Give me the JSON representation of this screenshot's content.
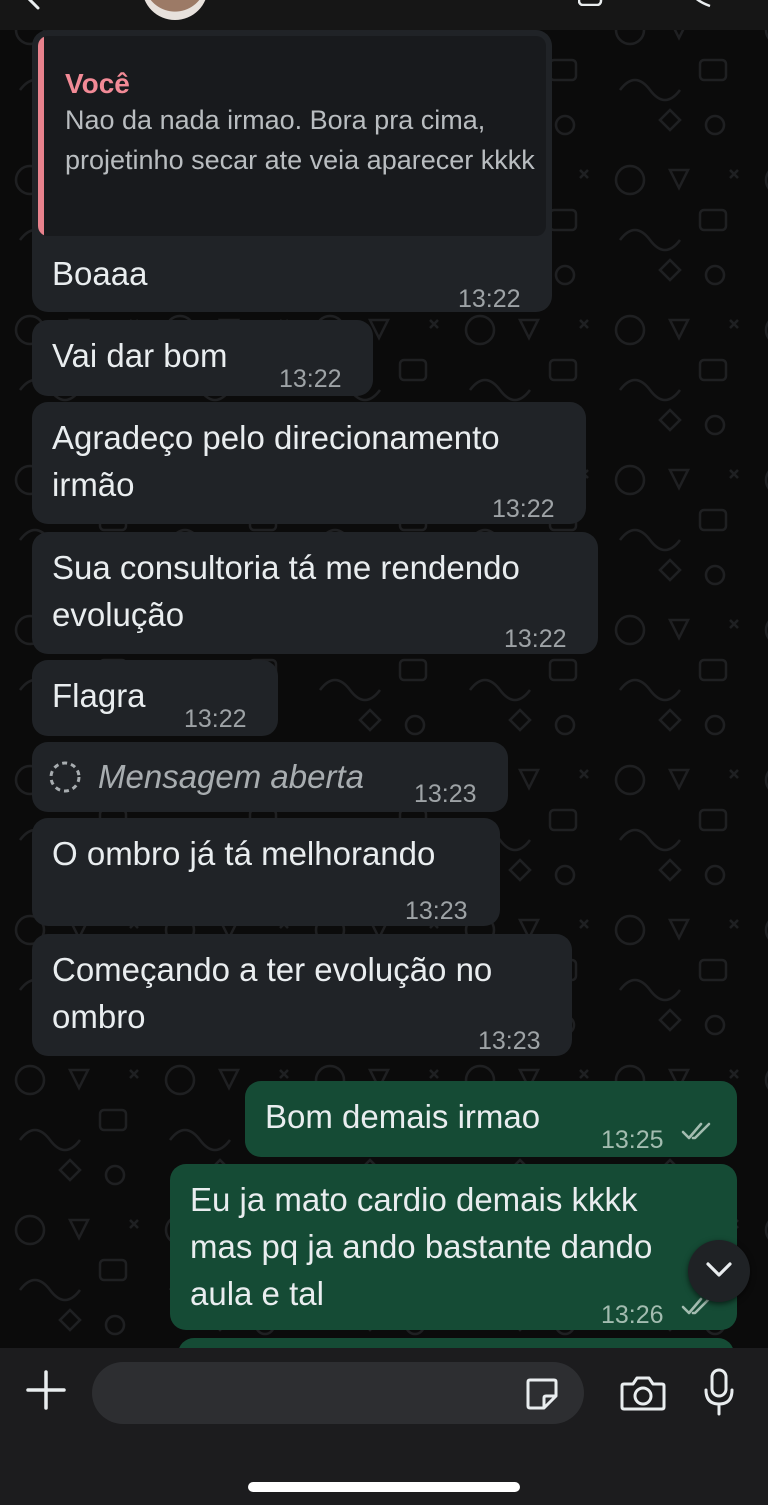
{
  "colors": {
    "incoming_bubble": "#202327",
    "outgoing_bubble": "#154b35",
    "quote_accent": "#e8828d",
    "read_ticks": "#a3bcb0"
  },
  "quoted": {
    "author": "Você",
    "text": "Nao da nada irmao. Bora pra cima, projetinho secar ate veia aparecer kkkk"
  },
  "messages": [
    {
      "dir": "in",
      "lines": [
        "Boaaa"
      ],
      "time": "13:22"
    },
    {
      "dir": "in",
      "lines": [
        "Vai dar bom"
      ],
      "time": "13:22"
    },
    {
      "dir": "in",
      "lines": [
        "Agradeço pelo direcionamento",
        "irmão"
      ],
      "time": "13:22"
    },
    {
      "dir": "in",
      "lines": [
        "Sua consultoria tá me rendendo",
        "evolução"
      ],
      "time": "13:22"
    },
    {
      "dir": "in",
      "lines": [
        "Flagra"
      ],
      "time": "13:22"
    },
    {
      "dir": "in",
      "view_once": true,
      "icon": "view-once-icon",
      "lines": [
        "Mensagem aberta"
      ],
      "time": "13:23"
    },
    {
      "dir": "in",
      "lines": [
        "O ombro já tá melhorando"
      ],
      "time": "13:23"
    },
    {
      "dir": "in",
      "lines": [
        "Começando a ter evolução no",
        "ombro"
      ],
      "time": "13:23"
    },
    {
      "dir": "out",
      "lines": [
        "Bom demais irmao"
      ],
      "time": "13:25",
      "status": "read-ticks-icon"
    },
    {
      "dir": "out",
      "lines": [
        "Eu ja mato cardio demais kkkk",
        "mas pq ja ando bastante dando",
        "aula e tal"
      ],
      "time": "13:26",
      "status": "read-ticks-icon"
    }
  ],
  "composer": {
    "placeholder": "",
    "icons": [
      "plus-icon",
      "sticker-icon",
      "camera-icon",
      "microphone-icon"
    ]
  },
  "header": {
    "icons": [
      "back-chevron-icon",
      "contact-avatar",
      "video-call-icon",
      "voice-call-icon"
    ]
  }
}
